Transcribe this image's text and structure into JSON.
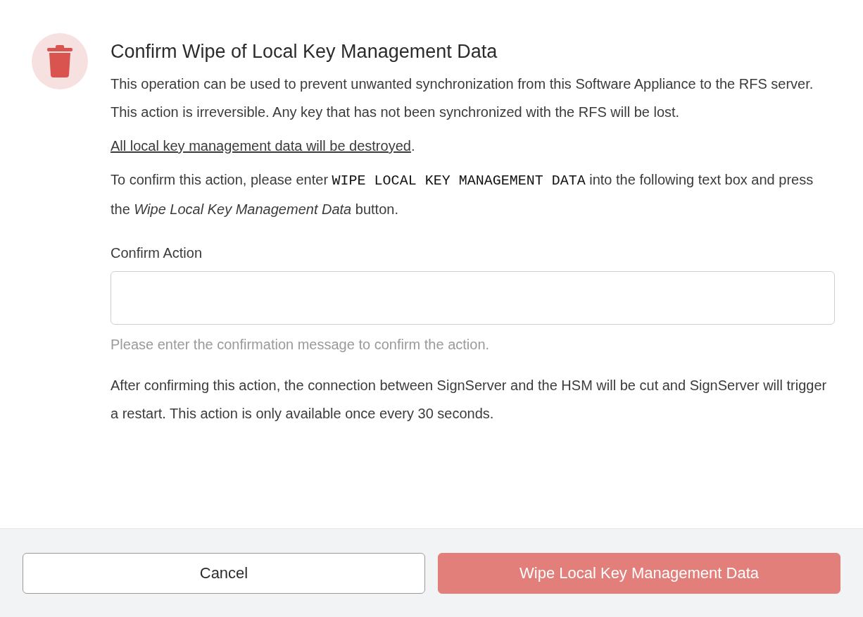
{
  "dialog": {
    "title": "Confirm Wipe of Local Key Management Data",
    "intro": "This operation can be used to prevent unwanted synchronization from this Software Appliance to the RFS server. This action is irreversible. Any key that has not been synchronized with the RFS will be lost.",
    "warning": {
      "underlined": "All local key management data will be destroyed",
      "after": "."
    },
    "instruction": {
      "before": "To confirm this action, please enter",
      "code": "WIPE LOCAL KEY MANAGEMENT DATA",
      "after": "into the following text box and press the *Wipe Local Key Management Data* button."
    },
    "field": {
      "label": "Confirm Action",
      "help": "Please enter the confirmation message to confirm the action."
    },
    "note": "After confirming this action, the connection between SignServer and the HSM will be cut and SignServer will trigger a restart. This action is only available once every 30 seconds.",
    "buttons": [
      {
        "label": "Cancel",
        "kind": "secondary",
        "disabled": false
      },
      {
        "label": "Wipe Local Key Management Data",
        "kind": "danger",
        "disabled": true
      }
    ]
  }
}
